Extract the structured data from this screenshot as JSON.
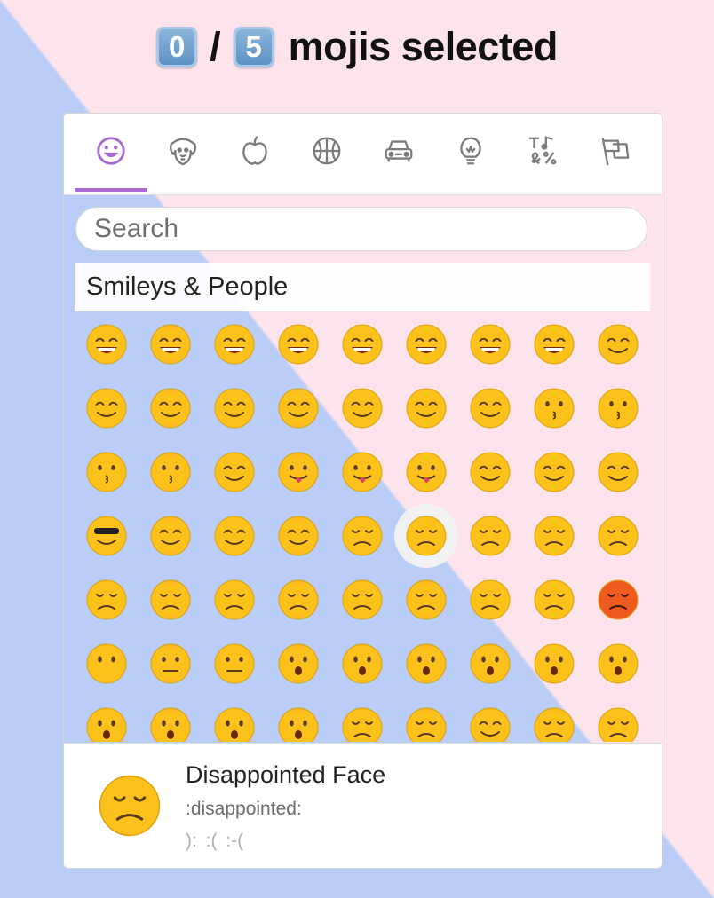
{
  "header": {
    "selected_count": "0",
    "separator": "/",
    "max_count": "5",
    "title": "mojis selected"
  },
  "tabs": [
    {
      "name": "smileys",
      "icon": "smiley-icon",
      "active": true
    },
    {
      "name": "animals",
      "icon": "dog-icon"
    },
    {
      "name": "food",
      "icon": "apple-icon"
    },
    {
      "name": "activity",
      "icon": "basketball-icon"
    },
    {
      "name": "travel",
      "icon": "car-icon"
    },
    {
      "name": "objects",
      "icon": "lightbulb-icon"
    },
    {
      "name": "symbols",
      "icon": "symbols-icon"
    },
    {
      "name": "flags",
      "icon": "flags-icon"
    }
  ],
  "search": {
    "placeholder": "Search"
  },
  "category": {
    "label": "Smileys & People"
  },
  "colors": {
    "accent": "#a86ad0",
    "face": "#fcc21b",
    "face_edge": "#e0a010",
    "feature": "#5a3a1a",
    "angry_face": "#ef5a1e"
  },
  "emojis": [
    [
      "grinning",
      "smiley",
      "smile",
      "grin",
      "laughing",
      "sweat_smile",
      "joy",
      "rofl",
      "relaxed"
    ],
    [
      "blush",
      "innocent",
      "slightly_smiling_face",
      "upside_down_face",
      "wink",
      "relieved",
      "heart_eyes",
      "kissing_heart",
      "kissing"
    ],
    [
      "kissing_smiling_eyes",
      "kissing_closed_eyes",
      "yum",
      "stuck_out_tongue_winking_eye",
      "stuck_out_tongue_closed_eyes",
      "stuck_out_tongue",
      "money_mouth_face",
      "hugs",
      "nerd_face"
    ],
    [
      "sunglasses",
      "clown_face",
      "cowboy_hat_face",
      "smirk",
      "unamused",
      "disappointed",
      "pensive",
      "worried",
      "confused"
    ],
    [
      "slightly_frowning_face",
      "frowning_face",
      "persevere",
      "confounded",
      "tired_face",
      "weary",
      "triumph",
      "angry",
      "rage"
    ],
    [
      "no_mouth",
      "neutral_face",
      "expressionless",
      "hushed",
      "frowning",
      "anguished",
      "open_mouth",
      "astonished",
      "dizzy_face"
    ],
    [
      "flushed",
      "scream",
      "fearful",
      "cold_sweat",
      "cry",
      "disappointed_relieved",
      "drooling_face",
      "sob",
      "sweat"
    ]
  ],
  "selected_emoji": "disappointed",
  "preview": {
    "name": "Disappointed Face",
    "short_name": ":disappointed:",
    "emoticons": "):  :(  :-("
  }
}
